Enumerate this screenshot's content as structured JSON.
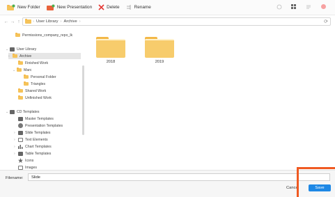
{
  "toolbar": {
    "new_folder": "New Folder",
    "new_presentation": "New Presentation",
    "delete": "Delete",
    "rename": "Rename"
  },
  "breadcrumb": [
    "User Library",
    "Archive"
  ],
  "sidebar": {
    "pinned": "Permissions_company_repo_lk",
    "user_library": "User Library",
    "archive": "Archive",
    "finished_work": "Finished Work",
    "marc": "Marc",
    "personal_folder": "Personal Folder",
    "triangles": "Triangles",
    "shared_work": "Shared Work",
    "unfinished_work": "Unfinished Work",
    "cd_templates": "CD Templates",
    "master_templates": "Master Templates",
    "presentation_templates": "Presentation Templates",
    "slide_templates": "Slide Templates",
    "text_elements": "Text Elements",
    "chart_templates": "Chart Templates",
    "table_templates": "Table Templates",
    "icons": "Icons",
    "images": "Images"
  },
  "main": {
    "folders": [
      "2018",
      "2019"
    ]
  },
  "bottom": {
    "filename_label": "Filename:",
    "filename_value": "Slide",
    "cancel": "Cancel",
    "save": "Save"
  },
  "colors": {
    "accent": "#1e88e5",
    "highlight": "#f05a22",
    "folder": "#f7cc6c"
  }
}
